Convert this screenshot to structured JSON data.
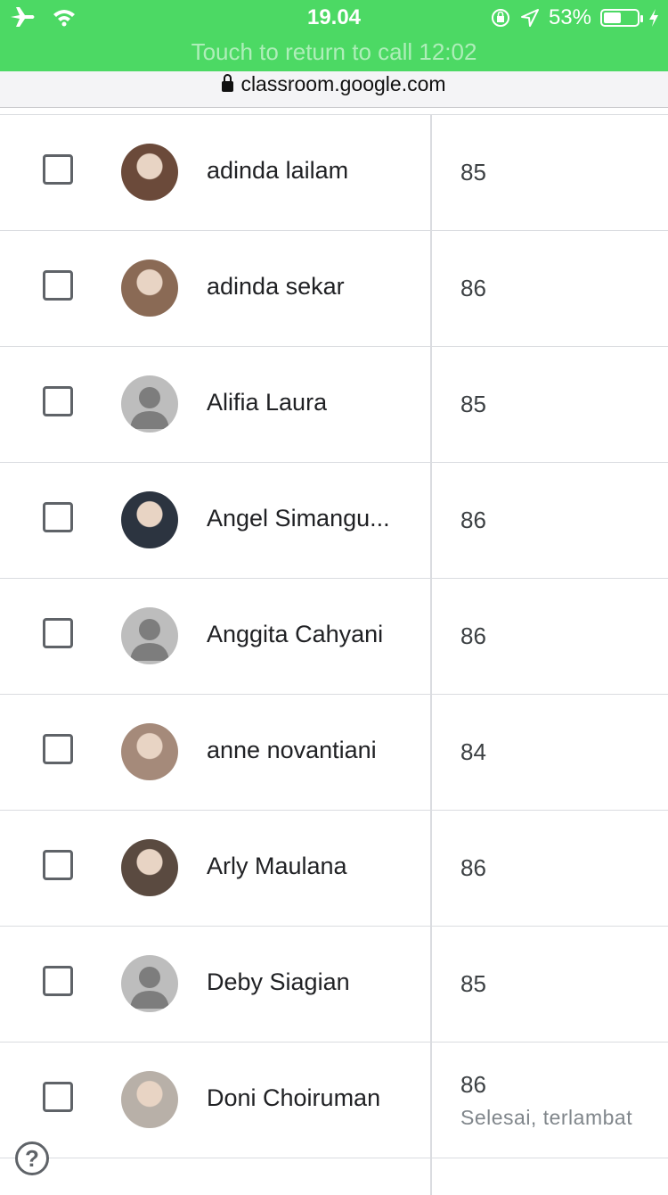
{
  "status_bar": {
    "time": "19.04",
    "call_text": "Touch to return to call 12:02",
    "battery_percent": "53%",
    "battery_level": 0.53,
    "left_icons": [
      "airplane-icon",
      "wifi-icon"
    ],
    "right_icons": [
      "orientation-lock-icon",
      "location-icon",
      "battery-icon",
      "charging-icon"
    ],
    "color": "#4cd964"
  },
  "browser": {
    "url": "classroom.google.com"
  },
  "students": [
    {
      "name": "adinda lailam",
      "grade": "85",
      "status": "",
      "avatar": "photo",
      "avatar_color": "#6b4a3a"
    },
    {
      "name": "adinda sekar",
      "grade": "86",
      "status": "",
      "avatar": "photo",
      "avatar_color": "#8a6a55"
    },
    {
      "name": "Alifia Laura",
      "grade": "85",
      "status": "",
      "avatar": "default",
      "avatar_color": "#bdbdbd"
    },
    {
      "name": "Angel Simangu...",
      "grade": "86",
      "status": "",
      "avatar": "photo",
      "avatar_color": "#2c3440"
    },
    {
      "name": "Anggita Cahyani",
      "grade": "86",
      "status": "",
      "avatar": "default",
      "avatar_color": "#bdbdbd"
    },
    {
      "name": "anne novantiani",
      "grade": "84",
      "status": "",
      "avatar": "photo",
      "avatar_color": "#a58a7a"
    },
    {
      "name": "Arly Maulana",
      "grade": "86",
      "status": "",
      "avatar": "photo",
      "avatar_color": "#5a4a40"
    },
    {
      "name": "Deby Siagian",
      "grade": "85",
      "status": "",
      "avatar": "default",
      "avatar_color": "#bdbdbd"
    },
    {
      "name": "Doni Choiruman",
      "grade": "86",
      "status": "Selesai, terlambat",
      "avatar": "photo",
      "avatar_color": "#b8b0a8"
    }
  ],
  "help_label": "?"
}
